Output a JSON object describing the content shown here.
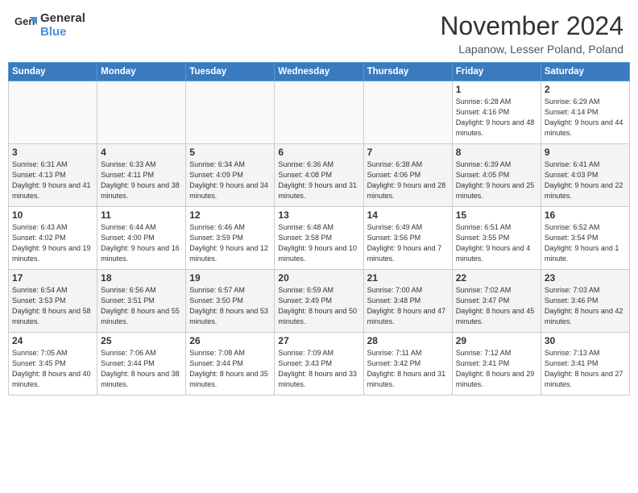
{
  "header": {
    "logo_general": "General",
    "logo_blue": "Blue",
    "month_title": "November 2024",
    "subtitle": "Lapanow, Lesser Poland, Poland"
  },
  "weekdays": [
    "Sunday",
    "Monday",
    "Tuesday",
    "Wednesday",
    "Thursday",
    "Friday",
    "Saturday"
  ],
  "weeks": [
    [
      {
        "day": "",
        "info": ""
      },
      {
        "day": "",
        "info": ""
      },
      {
        "day": "",
        "info": ""
      },
      {
        "day": "",
        "info": ""
      },
      {
        "day": "",
        "info": ""
      },
      {
        "day": "1",
        "info": "Sunrise: 6:28 AM\nSunset: 4:16 PM\nDaylight: 9 hours and 48 minutes."
      },
      {
        "day": "2",
        "info": "Sunrise: 6:29 AM\nSunset: 4:14 PM\nDaylight: 9 hours and 44 minutes."
      }
    ],
    [
      {
        "day": "3",
        "info": "Sunrise: 6:31 AM\nSunset: 4:13 PM\nDaylight: 9 hours and 41 minutes."
      },
      {
        "day": "4",
        "info": "Sunrise: 6:33 AM\nSunset: 4:11 PM\nDaylight: 9 hours and 38 minutes."
      },
      {
        "day": "5",
        "info": "Sunrise: 6:34 AM\nSunset: 4:09 PM\nDaylight: 9 hours and 34 minutes."
      },
      {
        "day": "6",
        "info": "Sunrise: 6:36 AM\nSunset: 4:08 PM\nDaylight: 9 hours and 31 minutes."
      },
      {
        "day": "7",
        "info": "Sunrise: 6:38 AM\nSunset: 4:06 PM\nDaylight: 9 hours and 28 minutes."
      },
      {
        "day": "8",
        "info": "Sunrise: 6:39 AM\nSunset: 4:05 PM\nDaylight: 9 hours and 25 minutes."
      },
      {
        "day": "9",
        "info": "Sunrise: 6:41 AM\nSunset: 4:03 PM\nDaylight: 9 hours and 22 minutes."
      }
    ],
    [
      {
        "day": "10",
        "info": "Sunrise: 6:43 AM\nSunset: 4:02 PM\nDaylight: 9 hours and 19 minutes."
      },
      {
        "day": "11",
        "info": "Sunrise: 6:44 AM\nSunset: 4:00 PM\nDaylight: 9 hours and 16 minutes."
      },
      {
        "day": "12",
        "info": "Sunrise: 6:46 AM\nSunset: 3:59 PM\nDaylight: 9 hours and 12 minutes."
      },
      {
        "day": "13",
        "info": "Sunrise: 6:48 AM\nSunset: 3:58 PM\nDaylight: 9 hours and 10 minutes."
      },
      {
        "day": "14",
        "info": "Sunrise: 6:49 AM\nSunset: 3:56 PM\nDaylight: 9 hours and 7 minutes."
      },
      {
        "day": "15",
        "info": "Sunrise: 6:51 AM\nSunset: 3:55 PM\nDaylight: 9 hours and 4 minutes."
      },
      {
        "day": "16",
        "info": "Sunrise: 6:52 AM\nSunset: 3:54 PM\nDaylight: 9 hours and 1 minute."
      }
    ],
    [
      {
        "day": "17",
        "info": "Sunrise: 6:54 AM\nSunset: 3:53 PM\nDaylight: 8 hours and 58 minutes."
      },
      {
        "day": "18",
        "info": "Sunrise: 6:56 AM\nSunset: 3:51 PM\nDaylight: 8 hours and 55 minutes."
      },
      {
        "day": "19",
        "info": "Sunrise: 6:57 AM\nSunset: 3:50 PM\nDaylight: 8 hours and 53 minutes."
      },
      {
        "day": "20",
        "info": "Sunrise: 6:59 AM\nSunset: 3:49 PM\nDaylight: 8 hours and 50 minutes."
      },
      {
        "day": "21",
        "info": "Sunrise: 7:00 AM\nSunset: 3:48 PM\nDaylight: 8 hours and 47 minutes."
      },
      {
        "day": "22",
        "info": "Sunrise: 7:02 AM\nSunset: 3:47 PM\nDaylight: 8 hours and 45 minutes."
      },
      {
        "day": "23",
        "info": "Sunrise: 7:03 AM\nSunset: 3:46 PM\nDaylight: 8 hours and 42 minutes."
      }
    ],
    [
      {
        "day": "24",
        "info": "Sunrise: 7:05 AM\nSunset: 3:45 PM\nDaylight: 8 hours and 40 minutes."
      },
      {
        "day": "25",
        "info": "Sunrise: 7:06 AM\nSunset: 3:44 PM\nDaylight: 8 hours and 38 minutes."
      },
      {
        "day": "26",
        "info": "Sunrise: 7:08 AM\nSunset: 3:44 PM\nDaylight: 8 hours and 35 minutes."
      },
      {
        "day": "27",
        "info": "Sunrise: 7:09 AM\nSunset: 3:43 PM\nDaylight: 8 hours and 33 minutes."
      },
      {
        "day": "28",
        "info": "Sunrise: 7:11 AM\nSunset: 3:42 PM\nDaylight: 8 hours and 31 minutes."
      },
      {
        "day": "29",
        "info": "Sunrise: 7:12 AM\nSunset: 3:41 PM\nDaylight: 8 hours and 29 minutes."
      },
      {
        "day": "30",
        "info": "Sunrise: 7:13 AM\nSunset: 3:41 PM\nDaylight: 8 hours and 27 minutes."
      }
    ]
  ]
}
